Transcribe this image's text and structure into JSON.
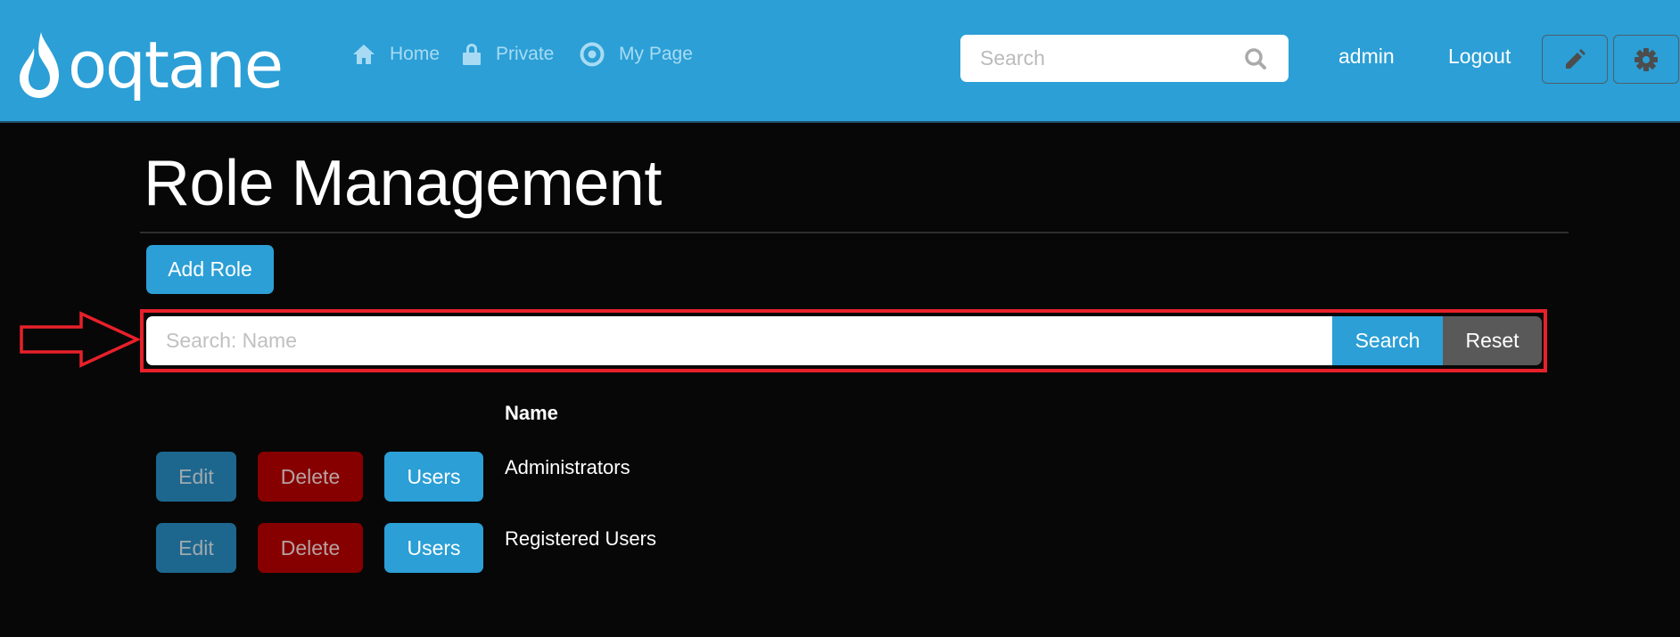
{
  "brand": {
    "name": "oqtane"
  },
  "nav": {
    "items": [
      {
        "label": "Home",
        "icon": "home-icon"
      },
      {
        "label": "Private",
        "icon": "lock-icon"
      },
      {
        "label": "My Page",
        "icon": "target-icon"
      }
    ]
  },
  "header": {
    "search_placeholder": "Search",
    "search_icon": "search-icon",
    "user_label": "admin",
    "logout_label": "Logout",
    "edit_icon": "pencil-icon",
    "settings_icon": "gear-icon"
  },
  "page": {
    "title": "Role Management",
    "add_button_label": "Add Role",
    "search": {
      "placeholder": "Search: Name",
      "value": "",
      "search_label": "Search",
      "reset_label": "Reset"
    },
    "table": {
      "columns": [
        "",
        "",
        "",
        "Name"
      ],
      "rows": [
        {
          "edit": "Edit",
          "delete": "Delete",
          "users": "Users",
          "name": "Administrators"
        },
        {
          "edit": "Edit",
          "delete": "Delete",
          "users": "Users",
          "name": "Registered Users"
        }
      ]
    }
  },
  "annotation": {
    "type": "arrow",
    "color": "#e8202a",
    "target": "search-bar"
  },
  "colors": {
    "header_bg": "#2b9fd6",
    "page_bg": "#070707",
    "primary": "#2b9fd6",
    "danger": "#860000",
    "secondary": "#595959",
    "highlight": "#e8202a"
  }
}
